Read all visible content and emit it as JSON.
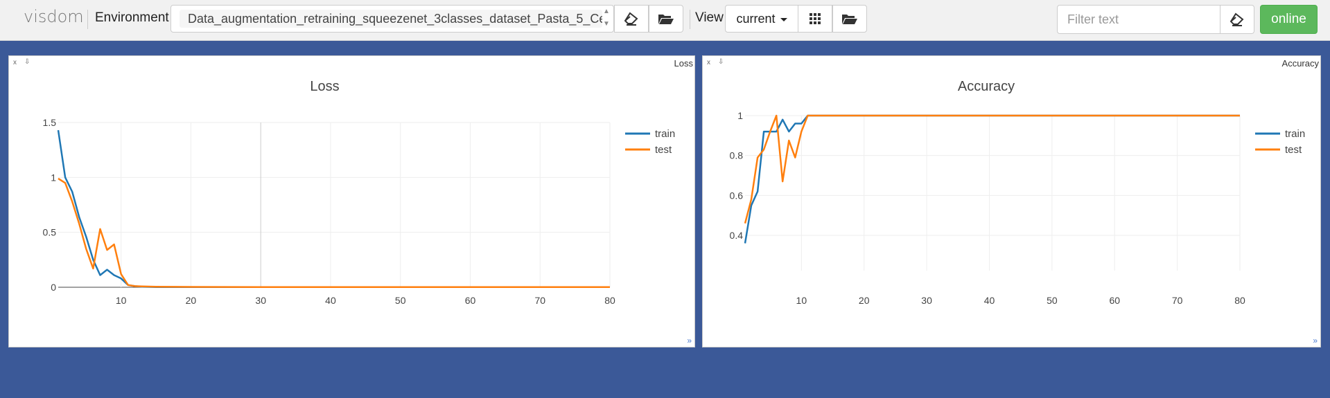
{
  "app": {
    "brand": "visdom",
    "environment_label": "Environment",
    "environment_value": "Data_augmentation_retraining_squeezenet_3classes_dataset_Pasta_5_Ce",
    "view_label": "View",
    "view_value": "current",
    "filter_placeholder": "Filter text",
    "status": "online"
  },
  "colors": {
    "train": "#1f77b4",
    "test": "#ff7f0e",
    "background": "#3b5998",
    "online": "#5cb85c"
  },
  "icons": [
    "eraser-icon",
    "folder-open-icon",
    "grid-icon",
    "folder-open-icon",
    "eraser-icon",
    "close-icon",
    "download-icon",
    "resize-icon"
  ],
  "panes": [
    {
      "window_title": "Loss",
      "close_label": "x",
      "download_label": "⇩"
    },
    {
      "window_title": "Accuracy",
      "close_label": "x",
      "download_label": "⇩"
    }
  ],
  "chart_data": [
    {
      "type": "line",
      "title": "Loss",
      "xlabel": "",
      "ylabel": "",
      "xlim": [
        1,
        80
      ],
      "ylim": [
        -0.05,
        1.55
      ],
      "xticks": [
        10,
        20,
        30,
        40,
        50,
        60,
        70,
        80
      ],
      "yticks": [
        0,
        0.5,
        1,
        1.5
      ],
      "ytick_labels": [
        "0",
        "0.5",
        "1",
        "1.5"
      ],
      "grid": true,
      "legend_position": "top-right",
      "series": [
        {
          "name": "train",
          "x": [
            1,
            2,
            3,
            4,
            5,
            6,
            7,
            8,
            9,
            10,
            11,
            12,
            13,
            14,
            15,
            20,
            30,
            40,
            50,
            60,
            70,
            80
          ],
          "y": [
            1.43,
            1.0,
            0.87,
            0.64,
            0.46,
            0.25,
            0.11,
            0.16,
            0.11,
            0.08,
            0.02,
            0.01,
            0.005,
            0.003,
            0.002,
            0.001,
            0.001,
            0.001,
            0.001,
            0.001,
            0.001,
            0.001
          ]
        },
        {
          "name": "test",
          "x": [
            1,
            2,
            3,
            4,
            5,
            6,
            7,
            8,
            9,
            10,
            11,
            12,
            13,
            14,
            15,
            20,
            30,
            40,
            50,
            60,
            70,
            80
          ],
          "y": [
            0.99,
            0.95,
            0.78,
            0.58,
            0.35,
            0.17,
            0.53,
            0.34,
            0.39,
            0.12,
            0.02,
            0.01,
            0.008,
            0.006,
            0.005,
            0.003,
            0.002,
            0.002,
            0.002,
            0.002,
            0.002,
            0.002
          ]
        }
      ]
    },
    {
      "type": "line",
      "title": "Accuracy",
      "xlabel": "",
      "ylabel": "",
      "xlim": [
        1,
        80
      ],
      "ylim": [
        0.33,
        1.05
      ],
      "xticks": [
        10,
        20,
        30,
        40,
        50,
        60,
        70,
        80
      ],
      "yticks": [
        0.4,
        0.6,
        0.8,
        1
      ],
      "ytick_labels": [
        "0.4",
        "0.6",
        "0.8",
        "1"
      ],
      "grid": true,
      "legend_position": "top-right",
      "series": [
        {
          "name": "train",
          "x": [
            1,
            2,
            3,
            4,
            5,
            6,
            7,
            8,
            9,
            10,
            11,
            12,
            20,
            30,
            40,
            50,
            60,
            70,
            80
          ],
          "y": [
            0.36,
            0.55,
            0.62,
            0.92,
            0.92,
            0.92,
            0.98,
            0.92,
            0.96,
            0.96,
            1.0,
            1.0,
            1.0,
            1.0,
            1.0,
            1.0,
            1.0,
            1.0,
            1.0
          ]
        },
        {
          "name": "test",
          "x": [
            1,
            2,
            3,
            4,
            5,
            6,
            7,
            8,
            9,
            10,
            11,
            12,
            20,
            30,
            40,
            50,
            60,
            70,
            80
          ],
          "y": [
            0.46,
            0.58,
            0.79,
            0.83,
            0.92,
            1.0,
            0.67,
            0.875,
            0.79,
            0.92,
            1.0,
            1.0,
            1.0,
            1.0,
            1.0,
            1.0,
            1.0,
            1.0,
            1.0
          ]
        }
      ]
    }
  ]
}
